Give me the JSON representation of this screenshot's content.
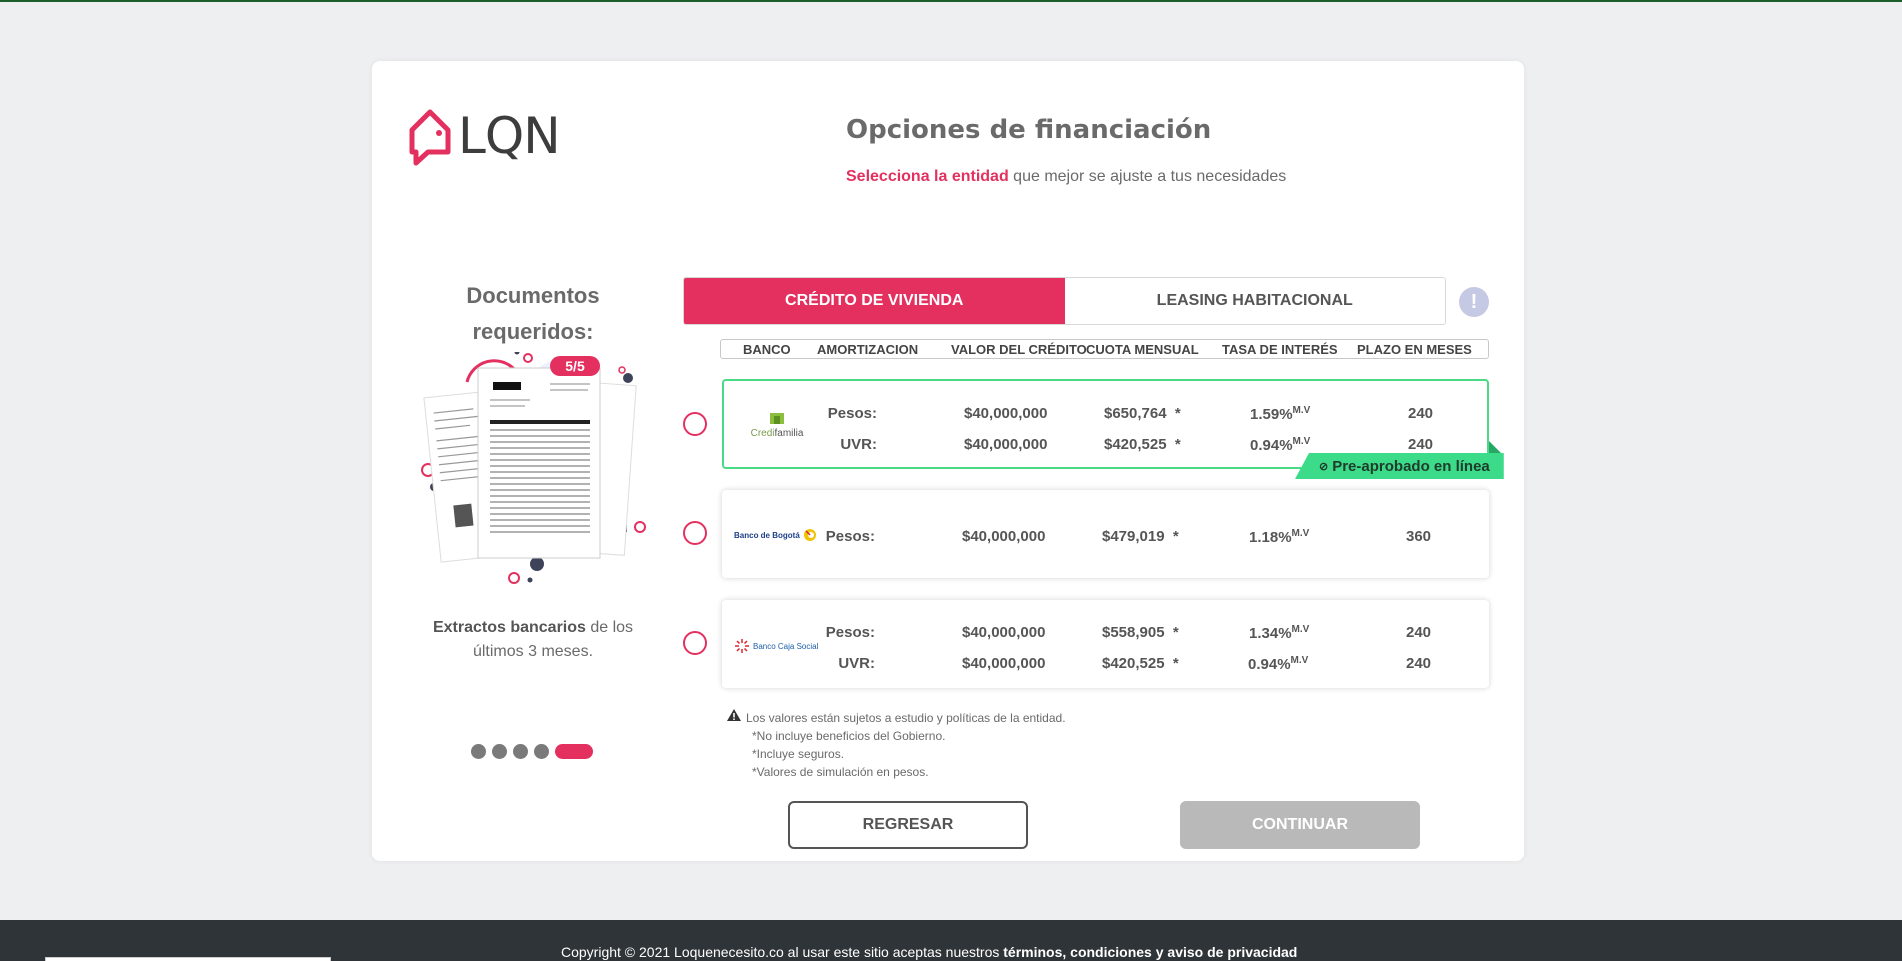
{
  "brand": {
    "name": "LQN",
    "accent": "#e3305f",
    "green": "#3bdb8a"
  },
  "header": {
    "title": "Opciones de financiación",
    "subtitle_highlight": "Selecciona la entidad",
    "subtitle_rest": " que mejor se ajuste a tus necesidades"
  },
  "docs": {
    "title": "Documentos requeridos:",
    "counter": "5/5",
    "caption_bold": "Extractos bancarios",
    "caption_rest": " de los últimos 3 meses.",
    "steps_total": 5,
    "step_active": 5
  },
  "tabs": [
    {
      "label": "CRÉDITO DE VIVIENDA",
      "active": true
    },
    {
      "label": "LEASING HABITACIONAL",
      "active": false
    }
  ],
  "info_button": "!",
  "columns": [
    "BANCO",
    "AMORTIZACION",
    "VALOR DEL CRÉDITO",
    "CUOTA MENSUAL",
    "TASA DE INTERÉS",
    "PLAZO EN MESES"
  ],
  "banks": [
    {
      "logo_text_1": "Credi",
      "logo_text_2": "familia",
      "selected": true,
      "badge": "Pre-aprobado en línea",
      "rows": [
        {
          "type": "Pesos:",
          "value": "$40,000,000",
          "fee": "$650,764",
          "star": "*",
          "rate": "1.59%",
          "rate_unit": "M.V",
          "term": "240"
        },
        {
          "type": "UVR:",
          "value": "$40,000,000",
          "fee": "$420,525",
          "star": "*",
          "rate": "0.94%",
          "rate_unit": "M.V",
          "term": "240"
        }
      ]
    },
    {
      "logo_text": "Banco de Bogotá",
      "selected": false,
      "rows": [
        {
          "type": "Pesos:",
          "value": "$40,000,000",
          "fee": "$479,019",
          "star": "*",
          "rate": "1.18%",
          "rate_unit": "M.V",
          "term": "360"
        }
      ]
    },
    {
      "logo_text": "Banco Caja Social",
      "selected": false,
      "rows": [
        {
          "type": "Pesos:",
          "value": "$40,000,000",
          "fee": "$558,905",
          "star": "*",
          "rate": "1.34%",
          "rate_unit": "M.V",
          "term": "240"
        },
        {
          "type": "UVR:",
          "value": "$40,000,000",
          "fee": "$420,525",
          "star": "*",
          "rate": "0.94%",
          "rate_unit": "M.V",
          "term": "240"
        }
      ]
    }
  ],
  "notes": {
    "main": "Los valores están sujetos a estudio y políticas de la entidad.",
    "items": [
      "*No incluye beneficios del Gobierno.",
      "*Incluye seguros.",
      "*Valores de simulación en pesos."
    ]
  },
  "buttons": {
    "back": "REGRESAR",
    "next": "CONTINUAR"
  },
  "footer": {
    "text": "Copyright © 2021 Loquenecesito.co al usar este sitio aceptas nuestros ",
    "link": "términos, condiciones y aviso de privacidad"
  }
}
